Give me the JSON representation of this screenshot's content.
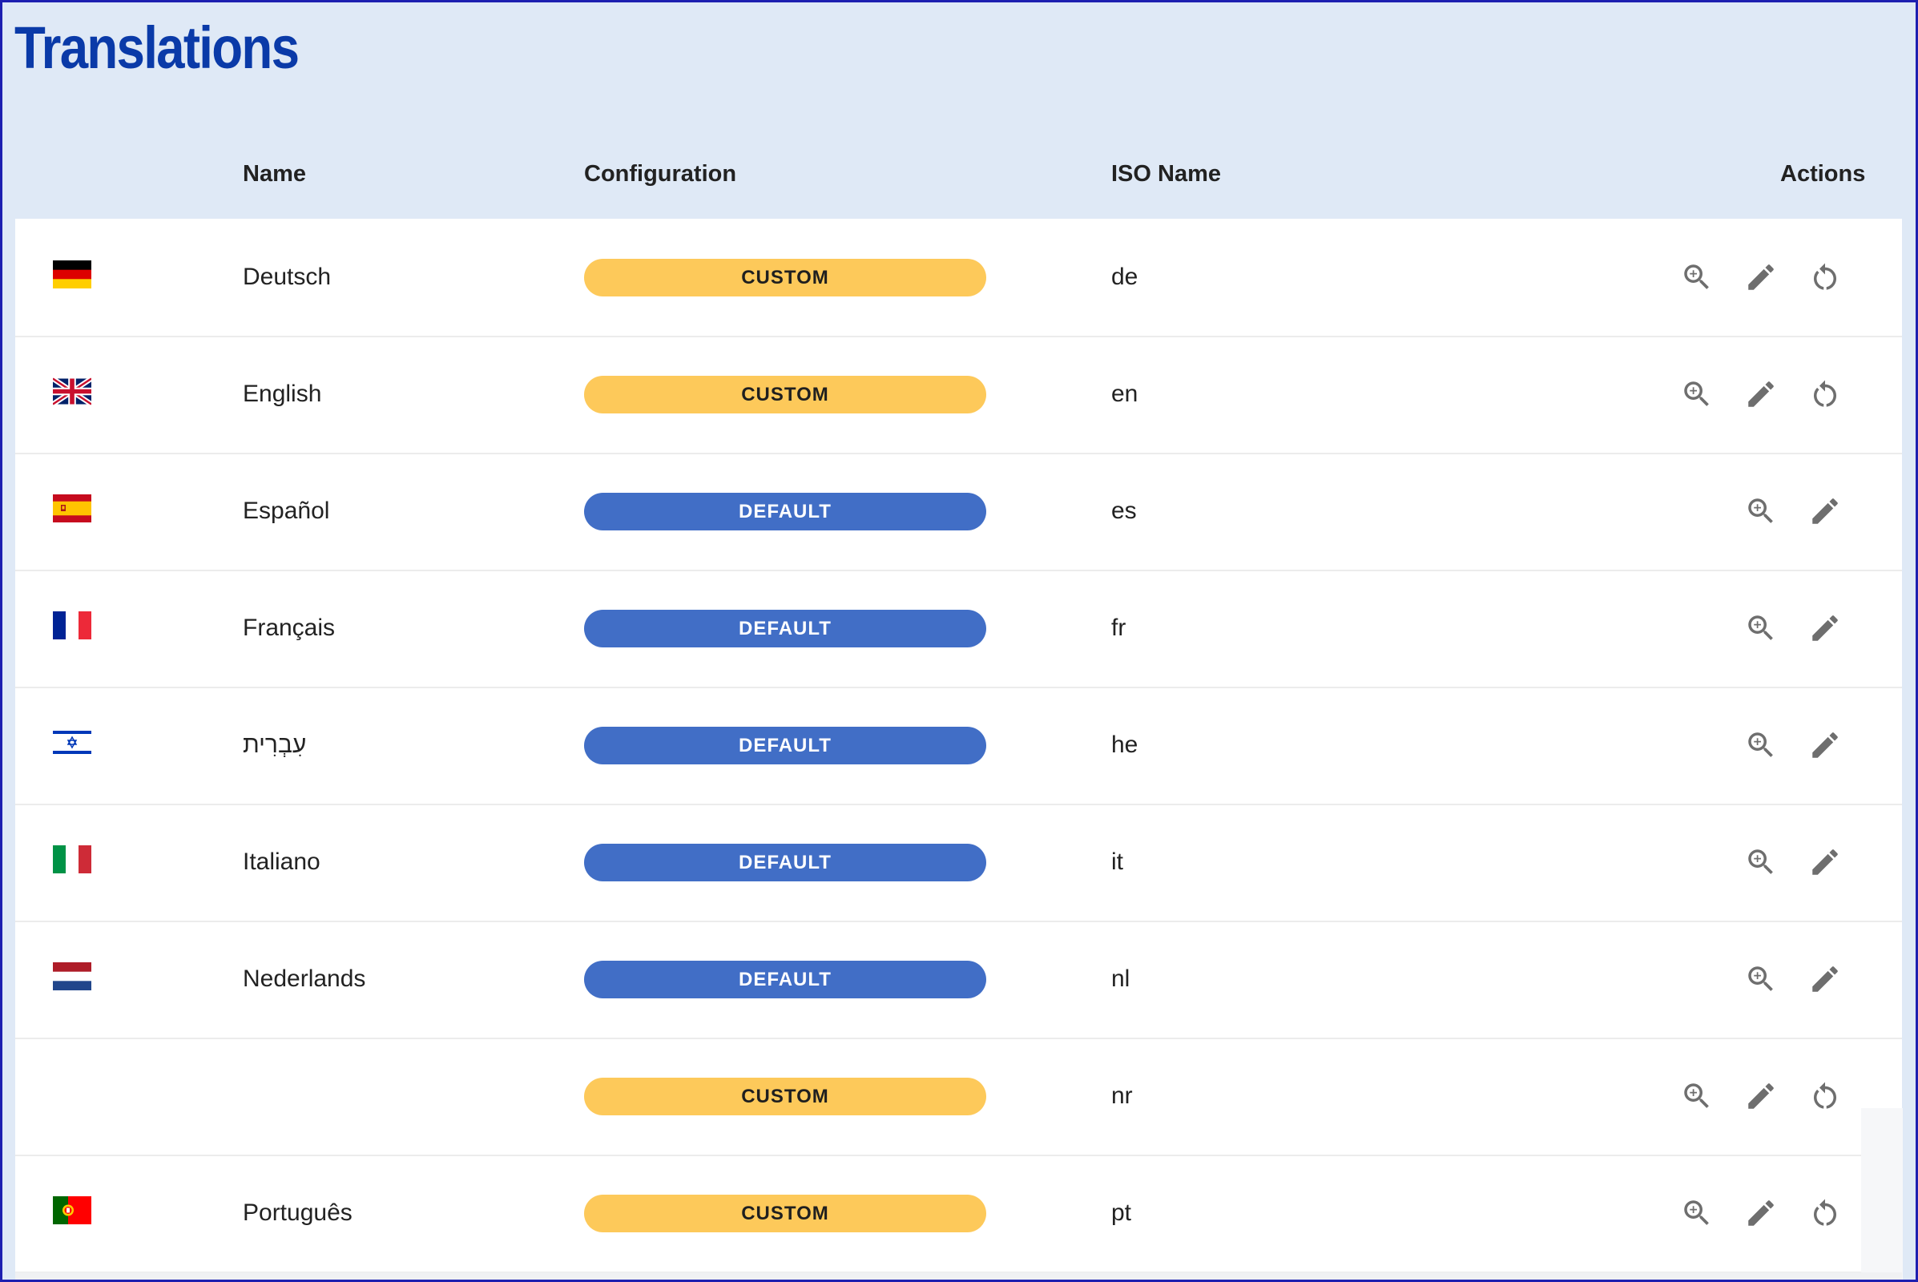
{
  "page": {
    "title": "Translations"
  },
  "columns": {
    "name": "Name",
    "configuration": "Configuration",
    "iso": "ISO Name",
    "actions": "Actions"
  },
  "colors": {
    "custom": "#fdc95a",
    "default": "#416ec6",
    "title": "#0a3aa8",
    "icon": "#6e6e6e"
  },
  "rows": [
    {
      "flag": "germany-flag",
      "name": "Deutsch",
      "config": "CUSTOM",
      "iso": "de",
      "actions": [
        "view",
        "edit",
        "reset"
      ]
    },
    {
      "flag": "uk-flag",
      "name": "English",
      "config": "CUSTOM",
      "iso": "en",
      "actions": [
        "view",
        "edit",
        "reset"
      ]
    },
    {
      "flag": "spain-flag",
      "name": "Español",
      "config": "DEFAULT",
      "iso": "es",
      "actions": [
        "view",
        "edit"
      ]
    },
    {
      "flag": "france-flag",
      "name": "Français",
      "config": "DEFAULT",
      "iso": "fr",
      "actions": [
        "view",
        "edit"
      ]
    },
    {
      "flag": "israel-flag",
      "name": "עִבְרִית",
      "config": "DEFAULT",
      "iso": "he",
      "actions": [
        "view",
        "edit"
      ]
    },
    {
      "flag": "italy-flag",
      "name": "Italiano",
      "config": "DEFAULT",
      "iso": "it",
      "actions": [
        "view",
        "edit"
      ]
    },
    {
      "flag": "netherlands-flag",
      "name": "Nederlands",
      "config": "DEFAULT",
      "iso": "nl",
      "actions": [
        "view",
        "edit"
      ]
    },
    {
      "flag": "",
      "name": "",
      "config": "CUSTOM",
      "iso": "nr",
      "actions": [
        "view",
        "edit",
        "reset"
      ]
    },
    {
      "flag": "portugal-flag",
      "name": "Português",
      "config": "CUSTOM",
      "iso": "pt",
      "actions": [
        "view",
        "edit",
        "reset"
      ]
    }
  ]
}
